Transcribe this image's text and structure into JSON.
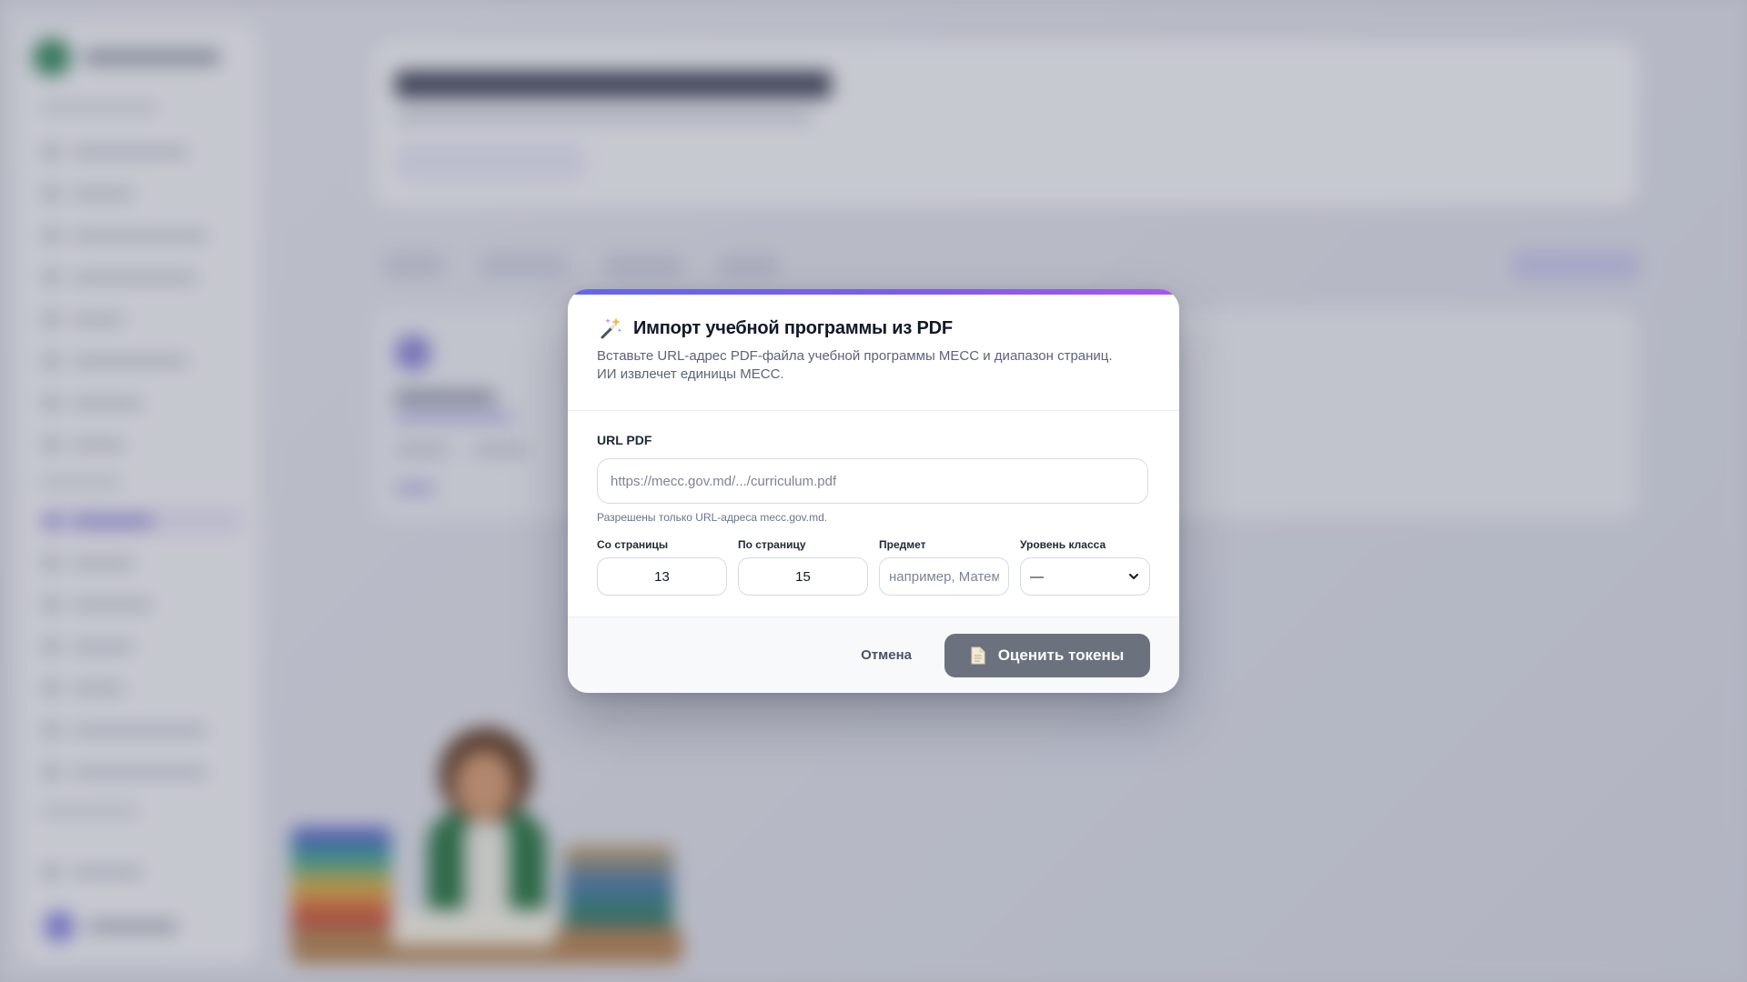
{
  "modal": {
    "title": "Импорт учебной программы из PDF",
    "description": "Вставьте URL-адрес PDF-файла учебной программы МЕСС и диапазон страниц. ИИ извлечет единицы МЕСС.",
    "title_icon": "magic-wand-sparkles-icon",
    "url": {
      "label": "URL PDF",
      "value": "",
      "placeholder": "https://mecc.gov.md/.../curriculum.pdf",
      "hint": "Разрешены только URL-адреса mecc.gov.md."
    },
    "from_page": {
      "label": "Со страницы",
      "value": "13"
    },
    "to_page": {
      "label": "По страницу",
      "value": "15"
    },
    "subject": {
      "label": "Предмет",
      "value": "",
      "placeholder": "например, Математика"
    },
    "grade_level": {
      "label": "Уровень класса",
      "value": "—"
    },
    "cancel_label": "Отмена",
    "submit_label": "Оценить токены",
    "submit_icon": "document-icon"
  },
  "colors": {
    "accent_gradient_start": "#6366f1",
    "accent_gradient_end": "#a855f7",
    "submit_button_bg": "#6b717d"
  }
}
